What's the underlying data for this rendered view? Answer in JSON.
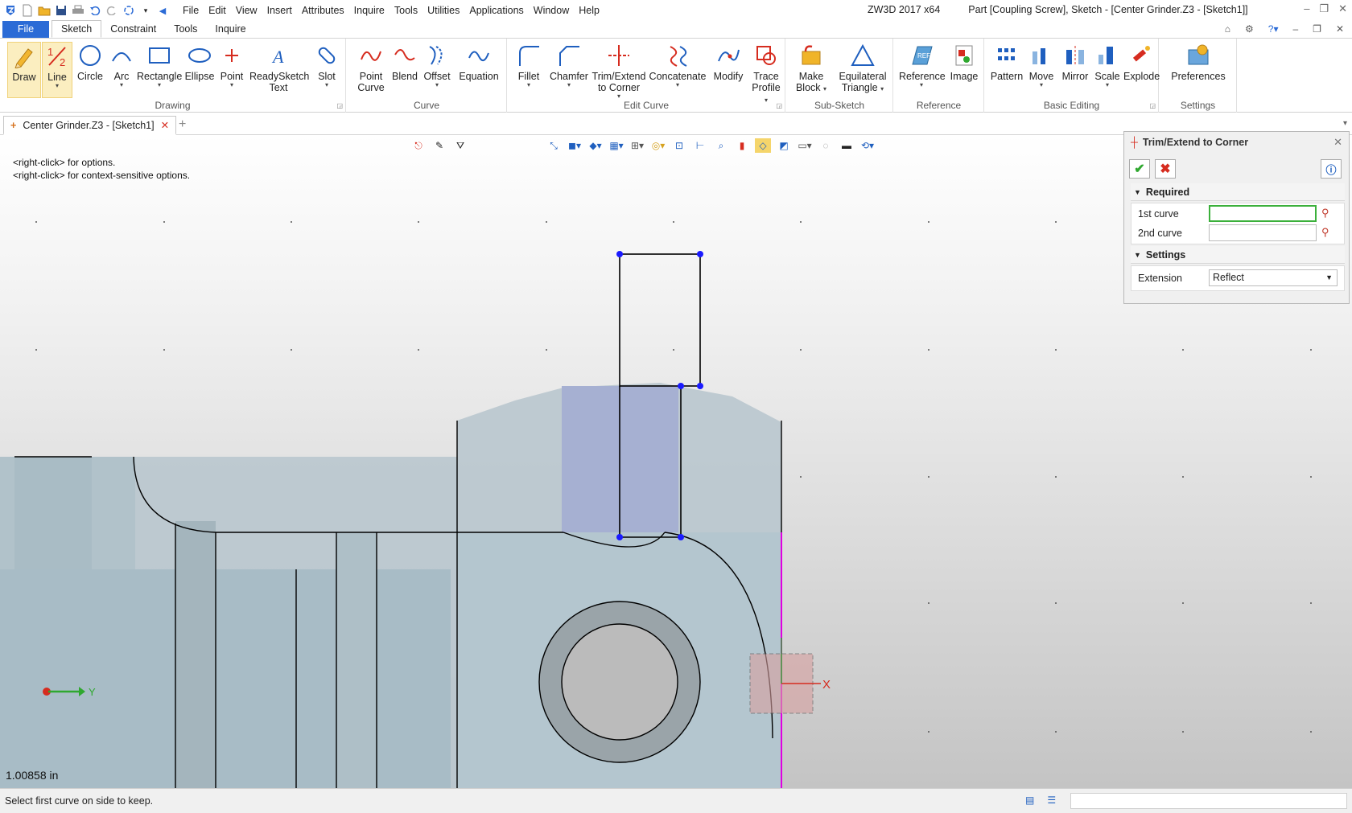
{
  "app": {
    "title": "ZW3D 2017  x64",
    "document_title": "Part [Coupling Screw],  Sketch - [Center Grinder.Z3 - [Sketch1]]"
  },
  "menu": [
    "File",
    "Edit",
    "View",
    "Insert",
    "Attributes",
    "Inquire",
    "Tools",
    "Utilities",
    "Applications",
    "Window",
    "Help"
  ],
  "ribbon_tabs": [
    "File",
    "Sketch",
    "Constraint",
    "Tools",
    "Inquire"
  ],
  "ribbon": {
    "drawing": {
      "label": "Drawing",
      "draw": "Draw",
      "line": "Line",
      "circle": "Circle",
      "arc": "Arc",
      "rectangle": "Rectangle",
      "ellipse": "Ellipse",
      "point": "Point",
      "readysketch_1": "ReadySketch",
      "readysketch_2": "Text",
      "slot": "Slot"
    },
    "curve": {
      "label": "Curve",
      "point_curve_1": "Point",
      "point_curve_2": "Curve",
      "blend": "Blend",
      "offset": "Offset",
      "equation": "Equation"
    },
    "edit_curve": {
      "label": "Edit Curve",
      "fillet": "Fillet",
      "chamfer": "Chamfer",
      "trim_1": "Trim/Extend",
      "trim_2": "to Corner",
      "concatenate": "Concatenate",
      "modify": "Modify",
      "trace_1": "Trace",
      "trace_2": "Profile"
    },
    "sub_sketch": {
      "label": "Sub-Sketch",
      "make_block_1": "Make",
      "make_block_2": "Block",
      "eq_tri_1": "Equilateral",
      "eq_tri_2": "Triangle"
    },
    "reference": {
      "label": "Reference",
      "reference": "Reference",
      "image": "Image"
    },
    "basic_editing": {
      "label": "Basic Editing",
      "pattern": "Pattern",
      "move": "Move",
      "mirror": "Mirror",
      "scale": "Scale",
      "explode": "Explode"
    },
    "settings": {
      "label": "Settings",
      "preferences": "Preferences"
    }
  },
  "doc_tab": {
    "label": "Center Grinder.Z3 - [Sketch1]"
  },
  "canvas": {
    "hint_1": "<right-click> for options.",
    "hint_2": "<right-click> for context-sensitive options.",
    "scale_readout": "1.00858 in",
    "axis_x": "X",
    "axis_y": "Y"
  },
  "dialog": {
    "title": "Trim/Extend to Corner",
    "required": "Required",
    "first_curve_label": "1st curve",
    "first_curve_value": "",
    "second_curve_label": "2nd curve",
    "second_curve_value": "",
    "settings": "Settings",
    "extension_label": "Extension",
    "extension_value": "Reflect"
  },
  "status": {
    "text": "Select first curve on side to keep."
  },
  "colors": {
    "accent": "#2b6bd6",
    "sketch_point": "#1a1aff",
    "selection_magenta": "#e000e0",
    "confirm_green": "#2fa82f",
    "cancel_red": "#d62c1f"
  }
}
